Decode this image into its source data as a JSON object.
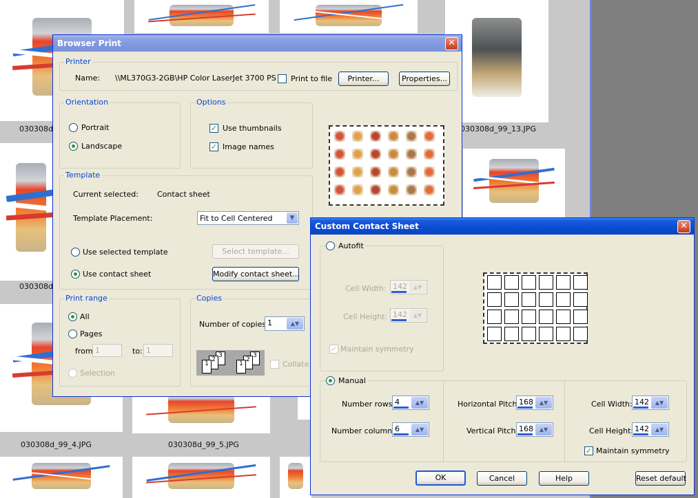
{
  "background": {
    "thumb_labels": [
      "030308d",
      "030308d_99_13.JPG",
      "030308d",
      "030308d_99_4.JPG",
      "030308d_99_5.JPG"
    ]
  },
  "browser_print": {
    "title": "Browser Print",
    "close_glyph": "✕",
    "printer": {
      "legend": "Printer",
      "name_label": "Name:",
      "name_value": "\\\\ML370G3-2GB\\HP Color LaserJet 3700 PS",
      "print_to_file": "Print to file",
      "printer_button": "Printer...",
      "properties_button": "Properties..."
    },
    "orientation": {
      "legend": "Orientation",
      "portrait": "Portrait",
      "landscape": "Landscape",
      "selected": "landscape"
    },
    "options": {
      "legend": "Options",
      "use_thumbnails": "Use thumbnails",
      "image_names": "Image names"
    },
    "template": {
      "legend": "Template",
      "current_label": "Current selected:",
      "current_value": "Contact sheet",
      "placement_label": "Template Placement:",
      "placement_value": "Fit to Cell Centered",
      "use_selected": "Use selected template",
      "select_button": "Select template...",
      "use_contact": "Use contact sheet",
      "modify_button": "Modify contact sheet..."
    },
    "print_range": {
      "legend": "Print range",
      "all": "All",
      "pages": "Pages",
      "from_label": "from:",
      "from_value": "1",
      "to_label": "to:",
      "to_value": "1",
      "selection": "Selection"
    },
    "copies": {
      "legend": "Copies",
      "number_label": "Number of copies:",
      "number_value": "1",
      "collate": "Collate",
      "page_digits": [
        "1",
        "2",
        "3"
      ]
    }
  },
  "contact_sheet": {
    "title": "Custom Contact Sheet",
    "close_glyph": "✕",
    "autofit": {
      "label": "Autofit",
      "cell_width_label": "Cell Width:",
      "cell_width_value": "142",
      "cell_height_label": "Cell Height:",
      "cell_height_value": "142",
      "maintain_symmetry": "Maintain symmetry"
    },
    "manual": {
      "label": "Manual",
      "rows_label": "Number rows:",
      "rows_value": "4",
      "cols_label": "Number columns:",
      "cols_value": "6",
      "hpitch_label": "Horizontal Pitch:",
      "hpitch_value": "168",
      "vpitch_label": "Vertical Pitch:",
      "vpitch_value": "168",
      "cell_width_label": "Cell Width:",
      "cell_width_value": "142",
      "cell_height_label": "Cell Height:",
      "cell_height_value": "142",
      "maintain_symmetry": "Maintain symmetry"
    },
    "buttons": {
      "ok": "OK",
      "cancel": "Cancel",
      "help": "Help",
      "reset": "Reset default"
    }
  }
}
